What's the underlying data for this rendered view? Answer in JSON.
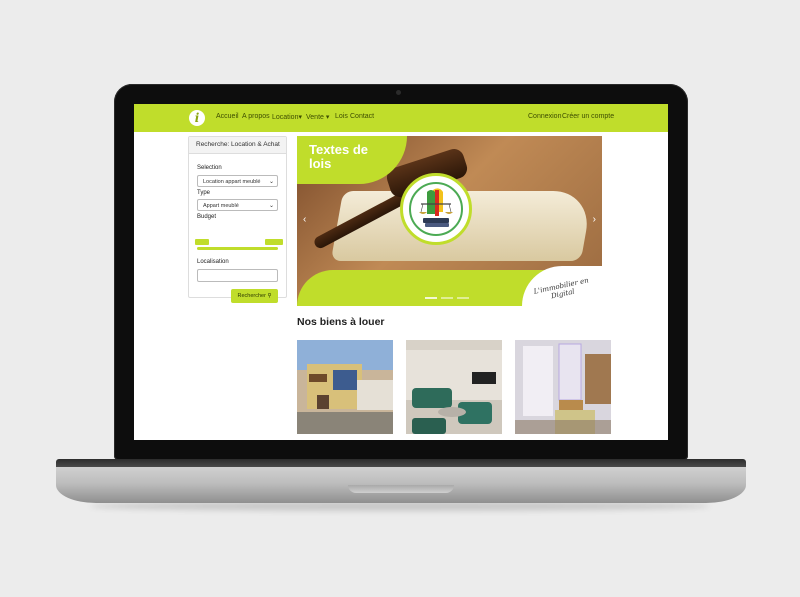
{
  "nav": {
    "logo": "i",
    "items": [
      "Accueil",
      "A propos",
      "Location",
      "Vente",
      "Lois",
      "Contact"
    ],
    "dropdown_marks": [
      "▾",
      "▾"
    ],
    "right": [
      "Connexion",
      "Créer un compte"
    ]
  },
  "search": {
    "title": "Recherche: Location & Achat",
    "selection_label": "Selection",
    "selection_value": "Location appart meublé",
    "type_label": "Type",
    "type_value": "Appart meublé",
    "budget_label": "Budget",
    "location_label": "Localisation",
    "button": "Rechercher"
  },
  "carousel": {
    "title": "Textes de lois",
    "tagline": "L'immobilier en Digital"
  },
  "section": {
    "title": "Nos biens à louer"
  },
  "colors": {
    "accent": "#c0dd2b"
  }
}
